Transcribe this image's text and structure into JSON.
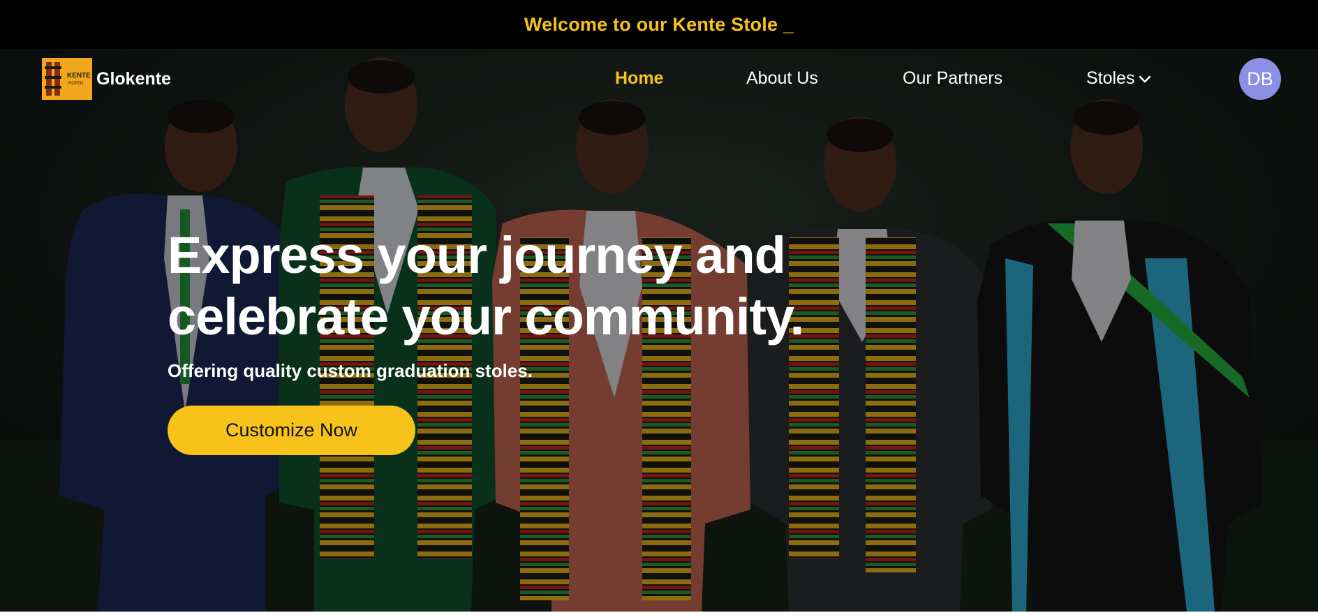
{
  "announcement": {
    "text": "Welcome to our Kente Stole _"
  },
  "brand": {
    "name": "Glokente",
    "logo_text_line1": "KENTE",
    "logo_text_line2": "ROTEN"
  },
  "nav": {
    "items": [
      {
        "label": "Home",
        "active": true
      },
      {
        "label": "About Us",
        "active": false
      },
      {
        "label": "Our Partners",
        "active": false
      },
      {
        "label": "Stoles",
        "active": false,
        "has_dropdown": true
      }
    ],
    "dropdown_icon": "chevron-down-icon"
  },
  "user": {
    "initials": "DB"
  },
  "hero": {
    "title_line1": "Express your journey and",
    "title_line2": "celebrate your community.",
    "subtitle": "Offering quality custom graduation stoles.",
    "cta_label": "Customize Now",
    "image_semantic": "five graduates wearing kente stoles"
  },
  "colors": {
    "accent": "#f7c31a",
    "announcement_bg": "#000000",
    "avatar_bg": "#8b8fe6",
    "text_light": "#ffffff"
  }
}
